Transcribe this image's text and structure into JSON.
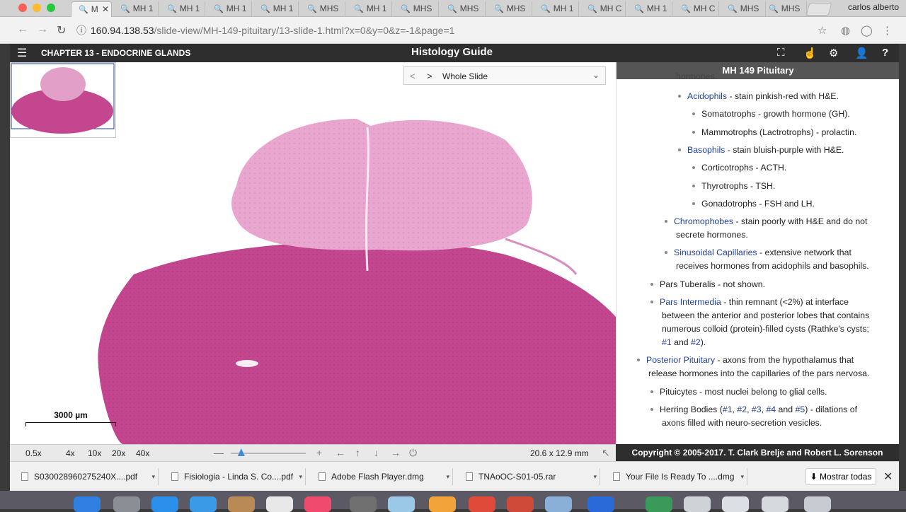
{
  "browser": {
    "tabs": [
      {
        "title": "M",
        "active": true,
        "has_close": true
      },
      {
        "title": "MH 1",
        "active": false
      },
      {
        "title": "MH 1",
        "active": false
      },
      {
        "title": "MH 1",
        "active": false
      },
      {
        "title": "MH 1",
        "active": false
      },
      {
        "title": "MHS",
        "active": false
      },
      {
        "title": "MH 1",
        "active": false
      },
      {
        "title": "MHS",
        "active": false
      },
      {
        "title": "MHS",
        "active": false
      },
      {
        "title": "MHS",
        "active": false
      },
      {
        "title": "MH 1",
        "active": false
      },
      {
        "title": "MH C",
        "active": false
      },
      {
        "title": "MH 1",
        "active": false
      },
      {
        "title": "MH C",
        "active": false
      },
      {
        "title": "MHS",
        "active": false
      },
      {
        "title": "MHS",
        "active": false
      }
    ],
    "close_glyph": "✕",
    "tab_icon": "🔍",
    "user_name": "carlos alberto",
    "url_host": "160.94.138.53",
    "url_path": "/slide-view/MH-149-pituitary/13-slide-1.html?x=0&y=0&z=-1&page=1"
  },
  "app": {
    "menu_glyph": "☰",
    "chapter": "CHAPTER 13 - ENDOCRINE GLANDS",
    "brand": "Histology Guide",
    "icons": {
      "fullscreen": "⛶",
      "pointer": "☝",
      "settings": "⚙",
      "user": "👤",
      "help": "?"
    }
  },
  "viewer": {
    "selector_prev": "<",
    "selector_next": ">",
    "selector_label": "Whole Slide",
    "selector_caret": "⌄",
    "scalebar_label": "3000 µm"
  },
  "sidebar": {
    "title": "MH 149 Pituitary",
    "partial_top": "hormones.",
    "lines": {
      "acido": "Acidophils",
      "acido_rest": " - stain pinkish-red with H&E.",
      "somato": "Somatotrophs - growth hormone (GH).",
      "mammo": "Mammotrophs (Lactrotrophs) - prolactin.",
      "baso": "Basophils",
      "baso_rest": " - stain bluish-purple with H&E.",
      "cortico": "Corticotrophs - ACTH.",
      "thyro": "Thyrotrophs - TSH.",
      "gonado": "Gonadotrophs - FSH and LH.",
      "chromo": "Chromophobes",
      "chromo_rest": " - stain poorly with H&E and do not",
      "chromo_2": "secrete hormones.",
      "sinus": "Sinusoidal Capillaries",
      "sinus_rest": " - extensive network that",
      "sinus_2": "receives hormones from acidophils and basophils.",
      "tuber": "Pars Tuberalis - not shown.",
      "inter": "Pars Intermedia",
      "inter_rest": " - thin remnant (<2%) at interface",
      "inter_2": "between the anterior and posterior lobes that contains",
      "inter_3": "numerous colloid (protein)-filled cysts (Rathke's cysts;",
      "inter_l1": "#1",
      "inter_and": " and ",
      "inter_l2": "#2",
      "inter_end": ").",
      "post": "Posterior Pituitary",
      "post_rest": " - axons from the hypothalamus that",
      "post_2": "release hormones into the capillaries of the pars nervosa.",
      "pitui": "Pituicytes - most nuclei belong to glial cells.",
      "herring_a": "Herring Bodies (",
      "h1": "#1",
      "comma": ", ",
      "h2": "#2",
      "h3": "#3",
      "h4": "#4",
      "and": " and ",
      "h5": "#5",
      "herring_b": ") - dilations of",
      "herring_2": "axons filled with neuro-secretion vesicles."
    }
  },
  "toolbar": {
    "zooms": [
      "0.5x",
      "4x",
      "10x",
      "20x",
      "40x"
    ],
    "zoom_slider_value": 0.14,
    "zoom_out": "—",
    "zoom_in": "+",
    "pan": {
      "left": "←",
      "up": "↑",
      "down": "↓",
      "right": "→"
    },
    "reset": "⏻",
    "dimensions": "20.6 x 12.9 mm",
    "expand": "↖"
  },
  "copyright": "Copyright © 2005-2017. T. Clark Brelje and Robert L. Sorenson",
  "downloads": {
    "items": [
      "S030028960275240X....pdf",
      "Fisiologia - Linda S. Co....pdf",
      "Adobe Flash Player.dmg",
      "TNAoOC-S01-05.rar",
      "Your File Is Ready To ....dmg"
    ],
    "caret": "▾",
    "show_all": "Mostrar todas",
    "show_all_icon": "⬇",
    "close": "✕"
  },
  "colors": {
    "header": "#2e2e2e",
    "tissue_dark": "#c4468f",
    "tissue_light": "#e9a7cf",
    "link": "#1f3f9e",
    "accent": "#3d8fd4"
  }
}
